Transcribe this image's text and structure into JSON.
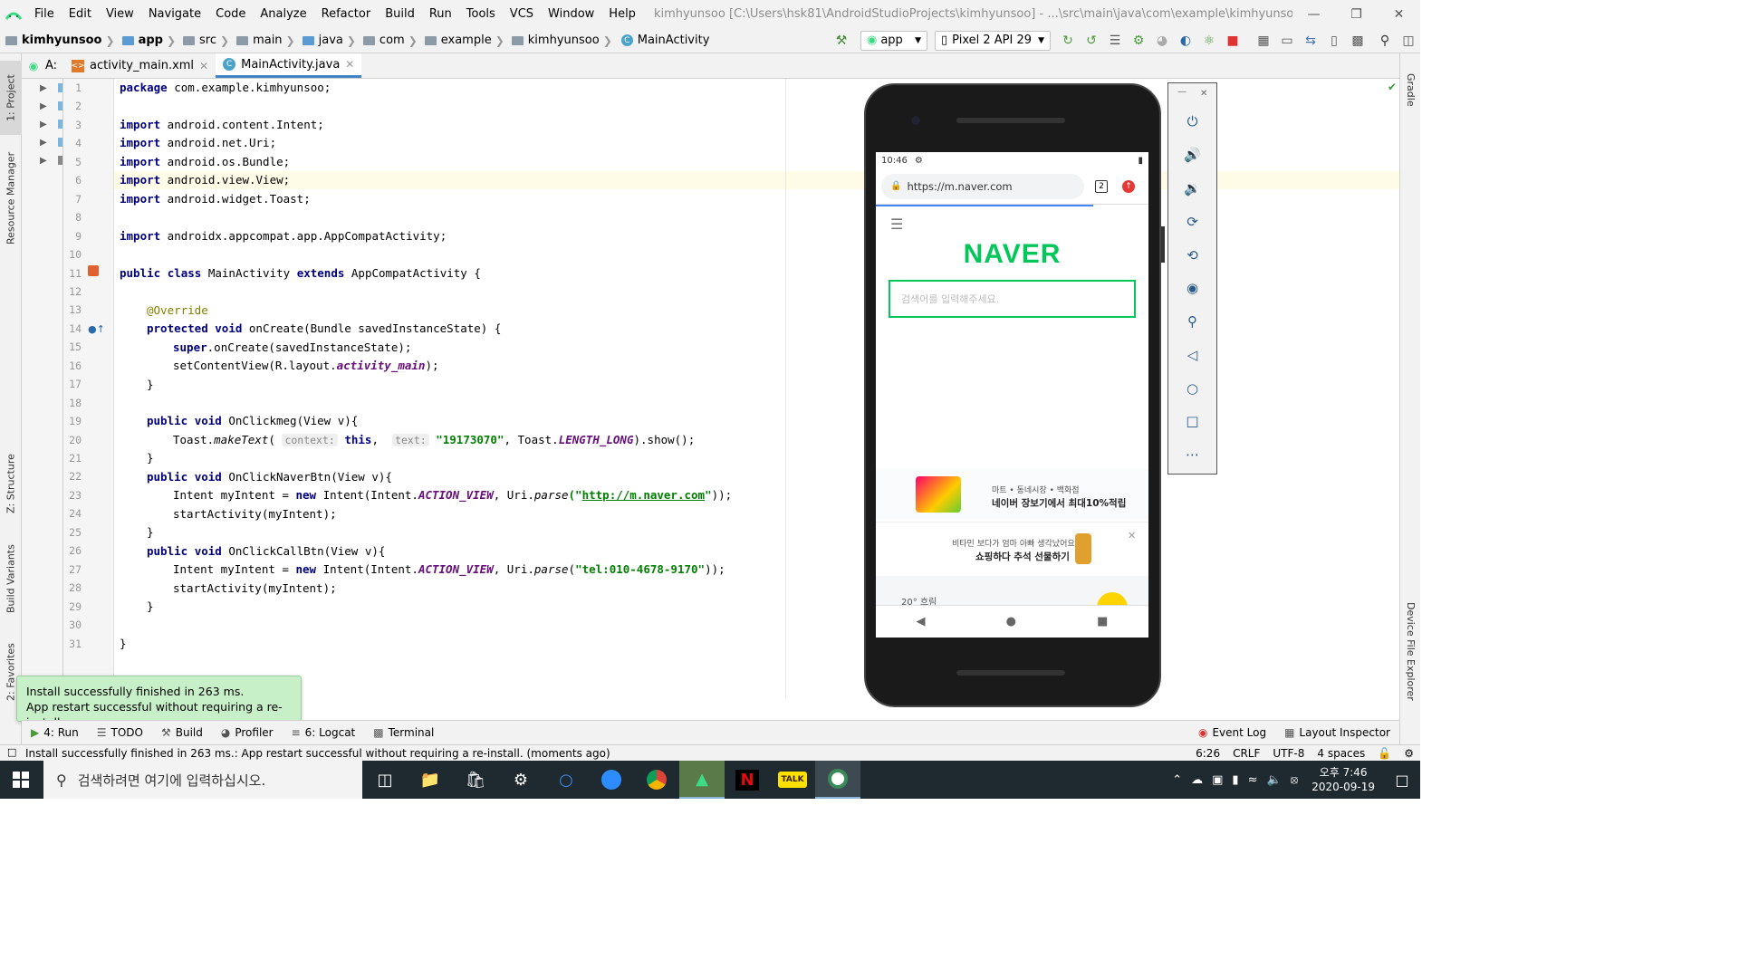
{
  "menu": {
    "items": [
      "File",
      "Edit",
      "View",
      "Navigate",
      "Code",
      "Analyze",
      "Refactor",
      "Build",
      "Run",
      "Tools",
      "VCS",
      "Window",
      "Help"
    ],
    "title": "kimhyunsoo [C:\\Users\\hsk81\\AndroidStudioProjects\\kimhyunsoo] - ...\\src\\main\\java\\com\\example\\kimhyunsoo\\MainActivity.java [app]"
  },
  "breadcrumbs": [
    "kimhyunsoo",
    "app",
    "src",
    "main",
    "java",
    "com",
    "example",
    "kimhyunsoo",
    "MainActivity"
  ],
  "toolbar": {
    "config": "app",
    "device": "Pixel 2 API 29"
  },
  "tabs": [
    {
      "label": "A:",
      "name": "tab-android-manifest"
    },
    {
      "label": "activity_main.xml"
    },
    {
      "label": "MainActivity.java"
    }
  ],
  "left_tools": [
    "1: Project",
    "Resource Manager",
    "Z: Structure",
    "Build Variants",
    "2: Favorites"
  ],
  "right_tools": [
    "Gradle",
    "Device File Explorer"
  ],
  "editor": {
    "line_numbers": [
      "1",
      "2",
      "3",
      "4",
      "5",
      "6",
      "7",
      "8",
      "9",
      "10",
      "11",
      "12",
      "13",
      "14",
      "15",
      "16",
      "17",
      "18",
      "19",
      "20",
      "21",
      "22",
      "23",
      "24",
      "25",
      "26",
      "27",
      "28",
      "29",
      "30",
      "31"
    ],
    "lines": {
      "l1a": "package",
      "l1b": " com.example.kimhyunsoo;",
      "imp": "import",
      "l3": " android.content.Intent;",
      "l4": " android.net.Uri;",
      "l5": " android.os.Bundle;",
      "l6": " android.view.View;",
      "l7": " android.widget.Toast;",
      "l9": " androidx.appcompat.app.AppCompatActivity;",
      "public": "public",
      "class": "class",
      "extends": "extends",
      "l11_name": " MainActivity ",
      "l11_parent": " AppCompatActivity {",
      "override": "@Override",
      "protected": "protected",
      "void": "void",
      "l14_sig": " onCreate(Bundle savedInstanceState) {",
      "super": "super",
      "l15_rest": ".onCreate(savedInstanceState);",
      "l16a": "setContentView(R.layout.",
      "l16b": "activity_main",
      "l16c": ");",
      "close": "}",
      "l19_sig": " OnClickmeg(View v){",
      "l20a": "Toast.",
      "l20b": "makeText",
      "l20c": "( ",
      "hint_context": "context:",
      "this": "this",
      "l20d": ", ",
      "hint_text": "text:",
      "l20str": "\"19173070\"",
      "l20e": ", Toast.",
      "l20f": "LENGTH_LONG",
      "l20g": ").show();",
      "l22_sig": " OnClickNaverBtn(View v){",
      "l23a": "Intent myIntent = ",
      "new": "new",
      "l23b": " Intent(Intent.",
      "action_view": "ACTION_VIEW",
      "l23c": ", Uri.",
      "parse": "parse",
      "l23q1": "(\"",
      "l23url": "http://m.naver.com",
      "l23q2": "\"",
      "l23d": "));",
      "l24": "startActivity(myIntent);",
      "l26_sig": " OnClickCallBtn(View v){",
      "l27str": "\"tel:010-4678-9170\"",
      "l27d": "));"
    }
  },
  "bottom_tabs": [
    "4: Run",
    "TODO",
    "Build",
    "Profiler",
    "6: Logcat",
    "Terminal"
  ],
  "bottom_right_tabs": [
    "Event Log",
    "Layout Inspector"
  ],
  "balloon": {
    "line1": "Install successfully finished in 263 ms.",
    "line2": "App restart successful without requiring a re-install."
  },
  "status": {
    "message": "Install successfully finished in 263 ms.: App restart successful without requiring a re-install. (moments ago)",
    "position": "6:26",
    "line_sep": "CRLF",
    "encoding": "UTF-8",
    "indent": "4 spaces"
  },
  "phone": {
    "time": "10:46",
    "url": "https://m.naver.com",
    "tab_count": "2",
    "logo": "NAVER",
    "search_placeholder": "검색어를 입력해주세요.",
    "ad1_small": "마트 • 동네시장 • 백화점",
    "ad1_big": "네이버 장보기에서 최대10%적립",
    "ad2_small": "비타민 보다가 엄마 아빠 생각났어요",
    "ad2_big": "쇼핑하다 추석 선물하기",
    "weather": "20° 흐림"
  },
  "taskbar": {
    "search_placeholder": "검색하려면 여기에 입력하십시오.",
    "time": "오후 7:46",
    "date": "2020-09-19"
  },
  "colors": {
    "accent": "#4083c9",
    "balloon": "#c8f0c8",
    "naver_green": "#03c75a",
    "keyword": "#000080",
    "string": "#008000"
  }
}
